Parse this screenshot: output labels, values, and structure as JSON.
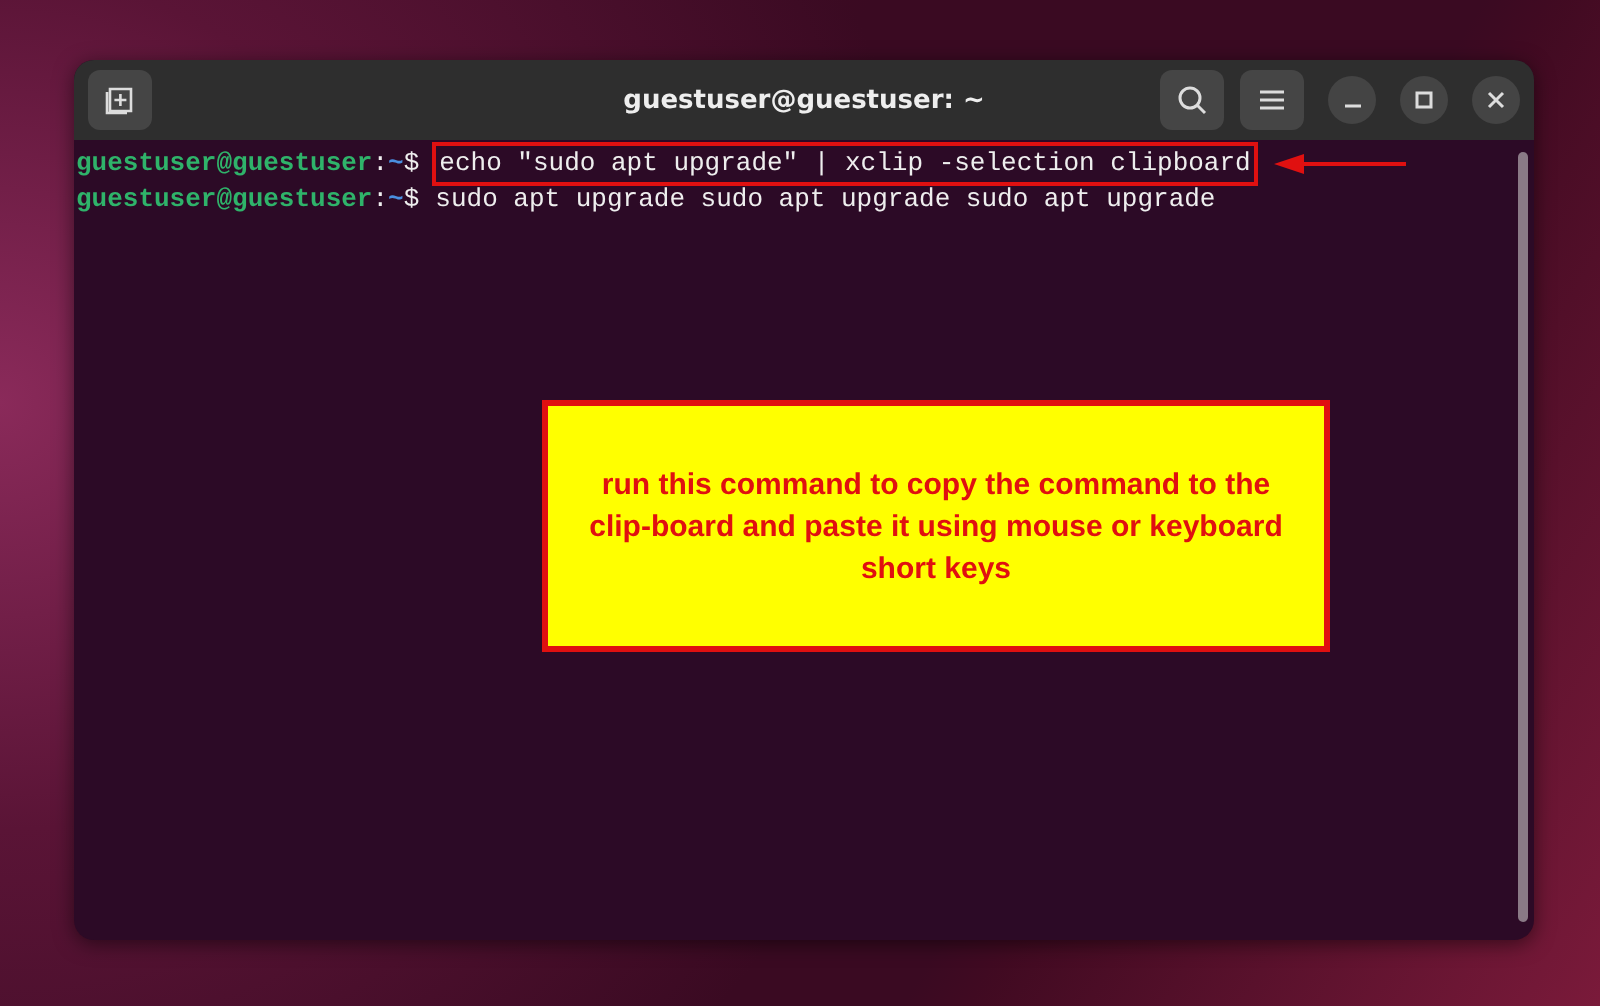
{
  "window": {
    "title": "guestuser@guestuser: ~"
  },
  "terminal": {
    "lines": [
      {
        "user_host": "guestuser@guestuser",
        "separator": ":",
        "path": "~",
        "symbol": "$",
        "command": "echo \"sudo apt upgrade\" | xclip -selection clipboard",
        "highlighted": true
      },
      {
        "user_host": "guestuser@guestuser",
        "separator": ":",
        "path": "~",
        "symbol": "$",
        "command": "sudo apt upgrade sudo apt upgrade sudo apt upgrade",
        "highlighted": false
      }
    ]
  },
  "callout": {
    "text": "run this command to copy the command to the clip-board and paste it using mouse or keyboard short keys"
  }
}
